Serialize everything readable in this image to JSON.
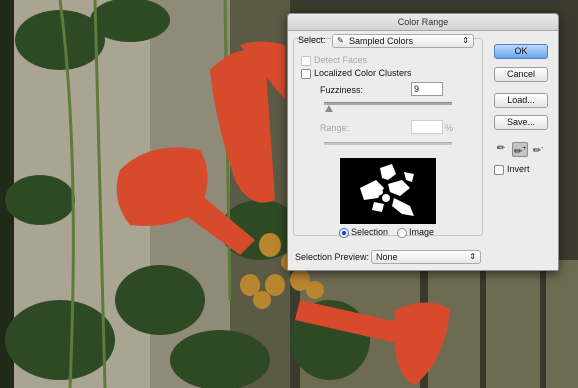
{
  "dialog": {
    "title": "Color Range",
    "select": {
      "label": "Select:",
      "value": "Sampled Colors",
      "icon": "eyedropper-icon"
    },
    "detect_faces": {
      "label": "Detect Faces",
      "checked": false,
      "enabled": false
    },
    "localized": {
      "label": "Localized Color Clusters",
      "checked": false
    },
    "fuzziness": {
      "label": "Fuzziness:",
      "value": "9",
      "slider_fraction": 0.04
    },
    "range": {
      "label": "Range:",
      "value": "",
      "unit": "%",
      "enabled": false
    },
    "preview_mode": {
      "selected": "Selection",
      "options": [
        "Selection",
        "Image"
      ]
    },
    "selection_preview": {
      "label": "Selection Preview:",
      "value": "None"
    },
    "buttons": {
      "ok": "OK",
      "cancel": "Cancel",
      "load": "Load...",
      "save": "Save..."
    },
    "tools": [
      "eyedropper-icon",
      "eyedropper-plus-icon",
      "eyedropper-minus-icon"
    ],
    "invert": {
      "label": "Invert",
      "checked": false
    },
    "colors": {
      "accent": "#6aa7ee",
      "panel": "#ececec"
    }
  }
}
